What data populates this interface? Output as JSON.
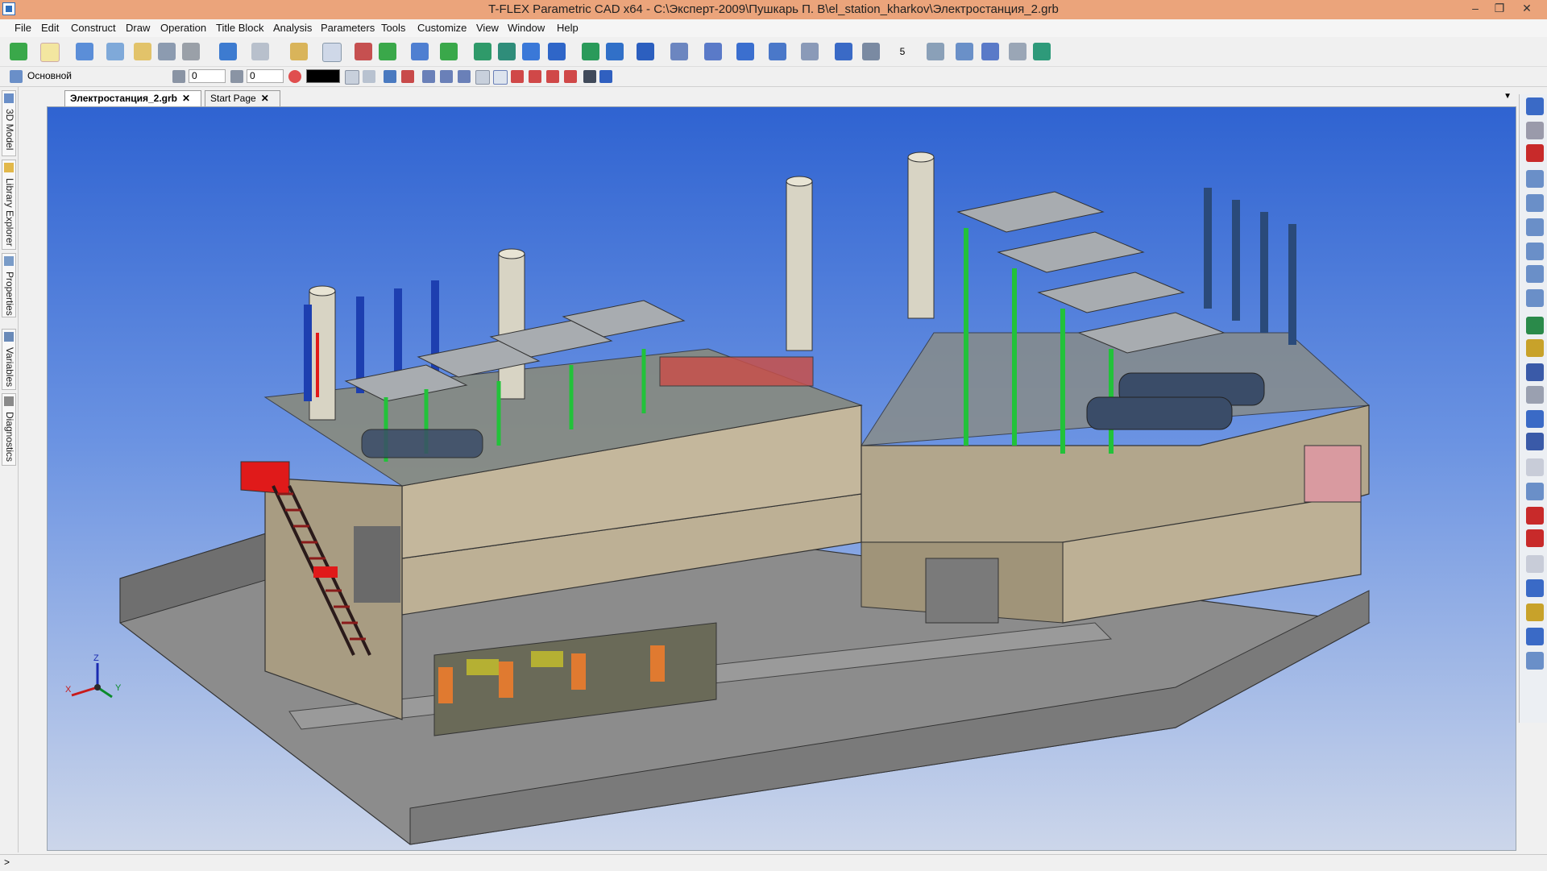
{
  "window": {
    "title": "T-FLEX Parametric CAD x64 - C:\\Эксперт-2009\\Пушкарь П. В\\el_station_kharkov\\Электростанция_2.grb",
    "controls": [
      "–",
      "❐",
      "✕"
    ]
  },
  "menu": [
    "File",
    "Edit",
    "Construct",
    "Draw",
    "Operation",
    "Title Block",
    "Analysis",
    "Parameters",
    "Tools",
    "Customize",
    "View",
    "Window",
    "Help"
  ],
  "layer_toolbar": {
    "layer_name": "Основной",
    "level_value": "0",
    "priority_value": "0",
    "line_color": "#000000"
  },
  "toolbar_extra": {
    "steps_value": "5"
  },
  "side_panels": [
    "3D Model",
    "Library Explorer",
    "Properties",
    "Variables",
    "Diagnostics"
  ],
  "tabs": [
    {
      "label": "Электростанция_2.grb",
      "close": "✕"
    },
    {
      "label": "Start Page",
      "close": "✕"
    }
  ],
  "axes": {
    "x": "X",
    "y": "Y",
    "z": "Z"
  },
  "status": {
    "text": ">"
  },
  "colors": {
    "titlebar": "#eba47b",
    "viewport_top": "#2f63d1",
    "viewport_bottom": "#ccd6ea",
    "building_wall": "#bdb095",
    "piping": "#22c23a",
    "stairs": "#e01a1a"
  }
}
